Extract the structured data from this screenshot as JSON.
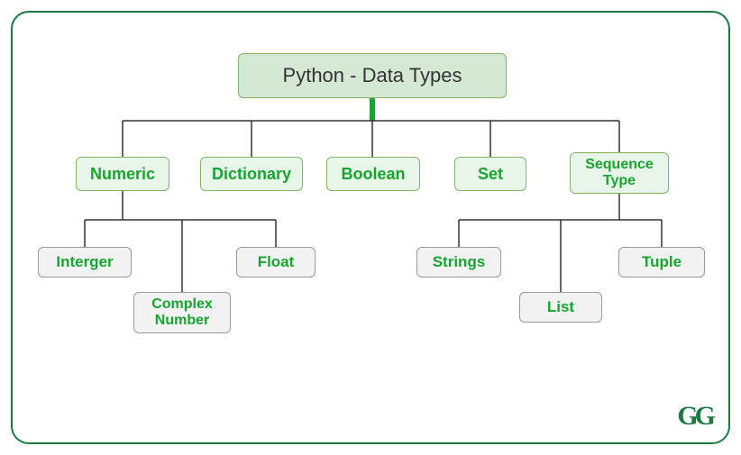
{
  "diagram": {
    "title": "Python - Data Types",
    "level1": {
      "numeric": "Numeric",
      "dictionary": "Dictionary",
      "boolean": "Boolean",
      "set": "Set",
      "sequence": "Sequence Type"
    },
    "numeric_children": {
      "integer": "Interger",
      "complex": "Complex Number",
      "float": "Float"
    },
    "sequence_children": {
      "strings": "Strings",
      "list": "List",
      "tuple": "Tuple"
    }
  },
  "logo": "GG"
}
